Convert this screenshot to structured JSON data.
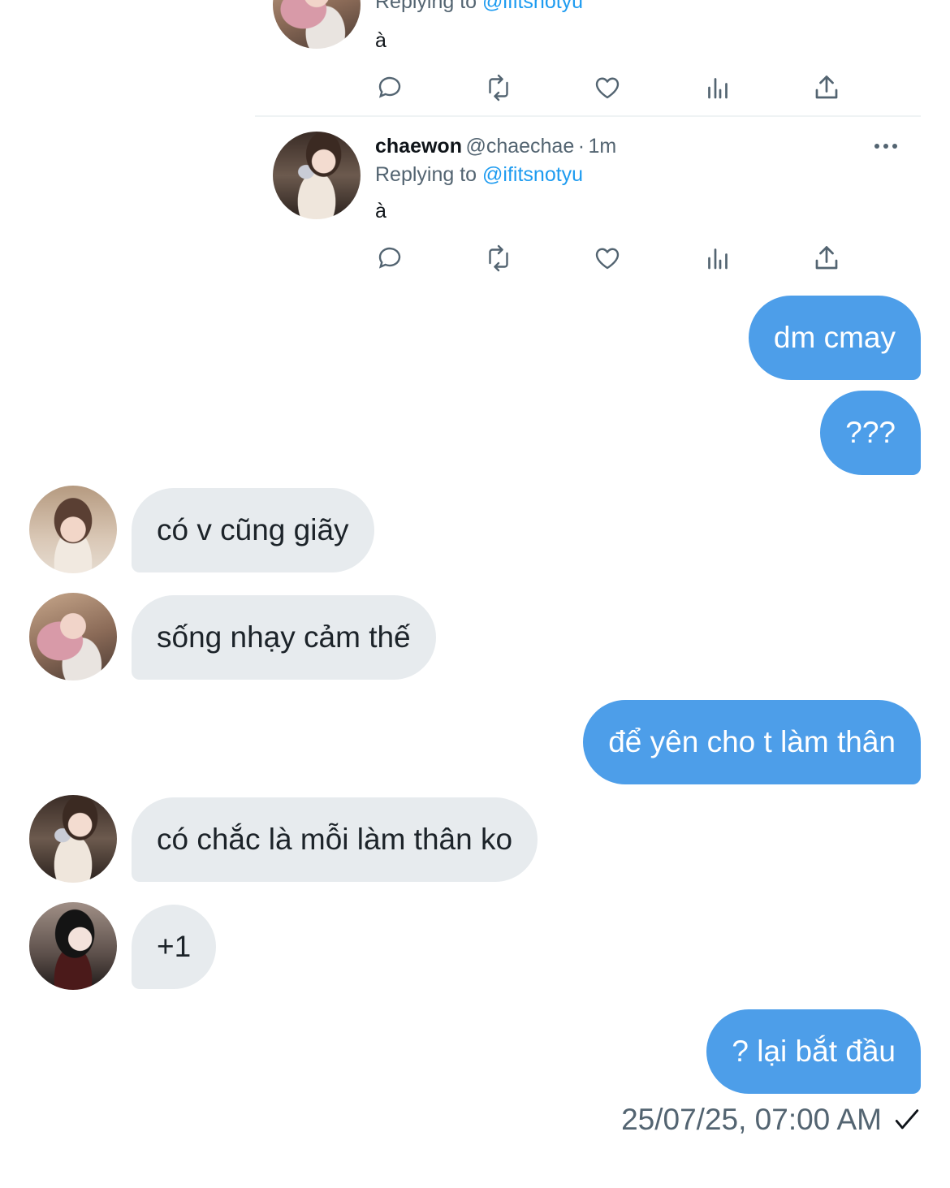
{
  "tweets": [
    {
      "partial": true,
      "replying_label": "Replying to",
      "replying_handle": "@ifitsnotyu",
      "body": "à"
    },
    {
      "name": "chaewon",
      "handle": "@chaechae",
      "separator": "·",
      "time": "1m",
      "replying_label": "Replying to",
      "replying_handle": "@ifitsnotyu",
      "body": "à"
    }
  ],
  "tweet_action_icons": [
    "reply-icon",
    "retweet-icon",
    "like-icon",
    "analytics-icon",
    "share-icon"
  ],
  "messages": [
    {
      "side": "sent",
      "text": "dm cmay"
    },
    {
      "side": "sent",
      "text": "???"
    },
    {
      "side": "received",
      "text": "có v cũng giãy",
      "avatar": "glasses"
    },
    {
      "side": "received",
      "text": "sống nhạy cảm thế",
      "avatar": "pink-hair"
    },
    {
      "side": "sent",
      "text": "để yên cho t làm thân"
    },
    {
      "side": "received",
      "text": "có chắc là mỗi làm thân ko",
      "avatar": "mirror-selfie"
    },
    {
      "side": "received",
      "text": "+1",
      "avatar": "dark-hair"
    },
    {
      "side": "sent",
      "text": "? lại bắt đầu"
    }
  ],
  "footer": {
    "timestamp": "25/07/25, 07:00 AM",
    "status_icon": "check-icon"
  },
  "colors": {
    "sent_bubble": "#4d9ee9",
    "received_bubble": "#e7ebee",
    "link": "#1d9bf0",
    "secondary_text": "#536471"
  }
}
